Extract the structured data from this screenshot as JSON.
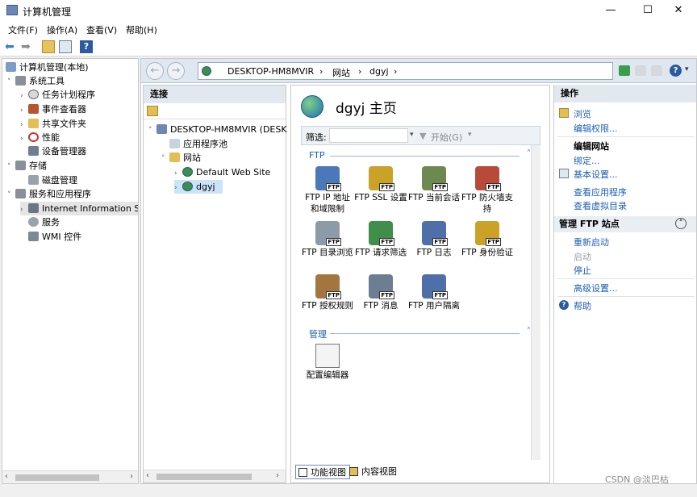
{
  "window": {
    "title": "计算机管理",
    "min": "—",
    "max": "☐",
    "close": "✕"
  },
  "menu": [
    "文件(F)",
    "操作(A)",
    "查看(V)",
    "帮助(H)"
  ],
  "tree": {
    "root": "计算机管理(本地)",
    "items": [
      {
        "label": "系统工具"
      },
      {
        "label": "任务计划程序"
      },
      {
        "label": "事件查看器"
      },
      {
        "label": "共享文件夹"
      },
      {
        "label": "性能"
      },
      {
        "label": "设备管理器"
      },
      {
        "label": "存储"
      },
      {
        "label": "磁盘管理"
      },
      {
        "label": "服务和应用程序"
      },
      {
        "label": "Internet Information S"
      },
      {
        "label": "服务"
      },
      {
        "label": "WMI 控件"
      }
    ]
  },
  "address": {
    "crumbs": [
      "DESKTOP-HM8MVIR",
      "网站",
      "dgyj"
    ]
  },
  "connections": {
    "header": "连接",
    "items": [
      "DESKTOP-HM8MVIR (DESK",
      "应用程序池",
      "网站",
      "Default Web Site",
      "dgyj"
    ]
  },
  "center": {
    "title": "dgyj 主页",
    "filter_label": "筛选:",
    "start_label": "开始(G)",
    "group_ftp": "FTP",
    "group_manage": "管理",
    "ftp_features": [
      "FTP IP 地址和域限制",
      "FTP SSL 设置",
      "FTP 当前会话",
      "FTP 防火墙支持",
      "FTP 目录浏览",
      "FTP 请求筛选",
      "FTP 日志",
      "FTP 身份验证",
      "FTP 授权规则",
      "FTP 消息",
      "FTP 用户隔离"
    ],
    "manage_features": [
      "配置编辑器"
    ],
    "ftp_tag": "FTP",
    "tab_features": "功能视图",
    "tab_content": "内容视图"
  },
  "actions": {
    "header": "操作",
    "browse": "浏览",
    "edit_perms": "编辑权限...",
    "edit_site": "编辑网站",
    "bindings": "绑定...",
    "basic": "基本设置...",
    "view_apps": "查看应用程序",
    "view_vdirs": "查看虚拟目录",
    "manage_ftp": "管理 FTP 站点",
    "restart": "重新启动",
    "start": "启动",
    "stop": "停止",
    "advanced": "高级设置...",
    "help": "帮助"
  },
  "watermark": "CSDN @淡巴枯"
}
